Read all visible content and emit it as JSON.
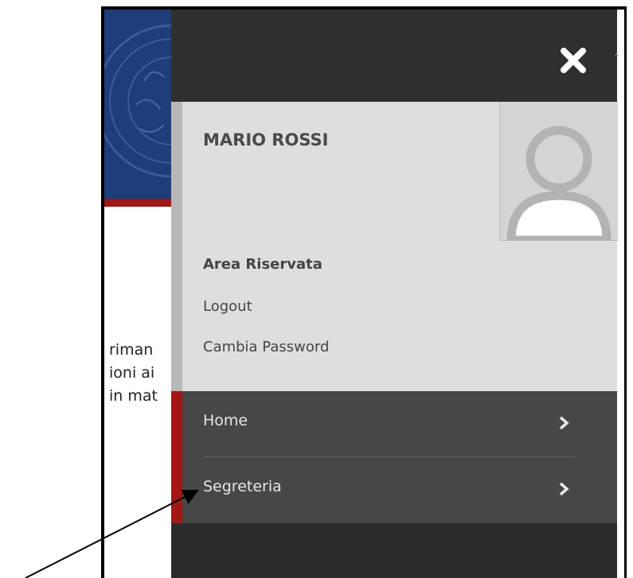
{
  "user": {
    "name": "MARIO ROSSI",
    "area_label": "Area Riservata",
    "links": [
      "Logout",
      "Cambia Password"
    ]
  },
  "menu": {
    "items": [
      {
        "label": "Home",
        "icon": "chevron-right-icon"
      },
      {
        "label": "Segreteria",
        "icon": "chevron-right-icon"
      }
    ]
  },
  "background_page": {
    "text_fragments": [
      "riman",
      "ioni ai",
      "in mat"
    ]
  },
  "icons": {
    "close": "close-icon",
    "avatar": "user-avatar-icon",
    "scroll": "chevron-up-icon"
  },
  "colors": {
    "drawer_dark": "#2f2f2f",
    "user_panel": "#dedede",
    "menu_bg": "#474747",
    "accent_red": "#a01818",
    "header_blue": "#1f3d7a"
  }
}
